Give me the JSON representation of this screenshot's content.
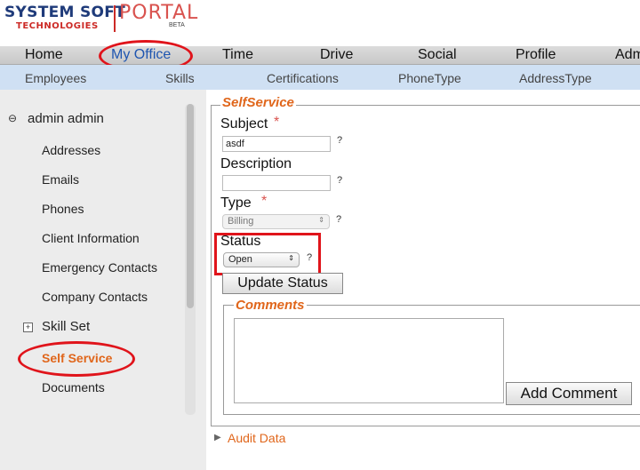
{
  "logo": {
    "line1": "SYSTEM SOFT",
    "line2": "TECHNOLOGIES",
    "product": "PORTAL",
    "badge": "BETA"
  },
  "topnav": {
    "items": [
      {
        "label": "Home"
      },
      {
        "label": "My Office"
      },
      {
        "label": "Time"
      },
      {
        "label": "Drive"
      },
      {
        "label": "Social"
      },
      {
        "label": "Profile"
      },
      {
        "label": "Adm"
      }
    ]
  },
  "subnav": {
    "items": [
      {
        "label": "Employees"
      },
      {
        "label": "Skills"
      },
      {
        "label": "Certifications"
      },
      {
        "label": "PhoneType"
      },
      {
        "label": "AddressType"
      }
    ]
  },
  "sidebar": {
    "root": "admin admin",
    "items": [
      "Addresses",
      "Emails",
      "Phones",
      "Client Information",
      "Emergency Contacts",
      "Company Contacts"
    ],
    "skillset": "Skill Set",
    "selfservice": "Self Service",
    "documents": "Documents"
  },
  "form": {
    "legend": "SelfService",
    "subject_label": "Subject",
    "required_mark": "*",
    "subject_value": "asdf",
    "description_label": "Description",
    "description_value": "",
    "type_label": "Type",
    "type_value": "Billing",
    "status_label": "Status",
    "status_value": "Open",
    "help": "?",
    "update_button": "Update Status",
    "comments_legend": "Comments",
    "add_comment_button": "Add Comment"
  },
  "audit": {
    "label": "Audit Data"
  },
  "colors": {
    "accent_orange": "#e0661b",
    "highlight_red": "#e0141b",
    "nav_blue": "#1e55b0",
    "subnav_bg": "#cfe0f3"
  }
}
